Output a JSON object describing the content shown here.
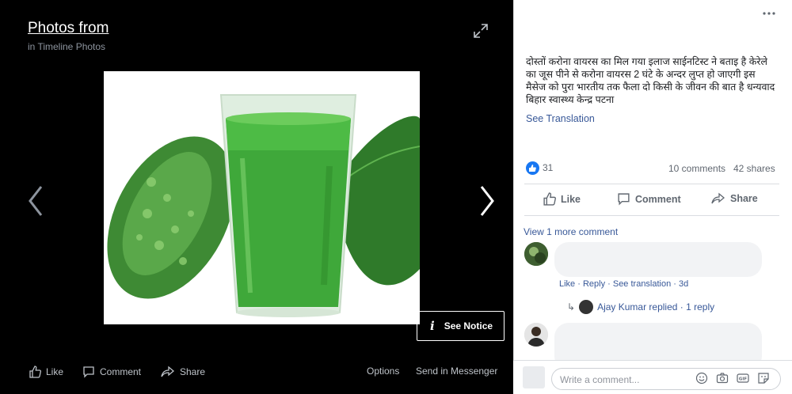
{
  "viewer": {
    "album_title": "Photos from",
    "album_subtitle": "in Timeline Photos",
    "see_notice": "See Notice",
    "bottom": {
      "like": "Like",
      "comment": "Comment",
      "share": "Share",
      "options": "Options",
      "send": "Send in Messenger"
    }
  },
  "post": {
    "caption": "दोस्तों करोना वायरस का मिल गया इलाज साईनटिस्ट ने बताइ है केरेले का जूस पीने से करोना वायरस 2 घंटे के अन्दर लुप्त हो जाएगी इस मैसेज को पुरा भारतीय तक फैला दो किसी के जीवन की बात है धन्यवाद बिहार स्वास्थ्य केन्द्र पटना",
    "see_translation": "See Translation",
    "reactions": "31",
    "comments": "10 comments",
    "shares": "42 shares",
    "actions": {
      "like": "Like",
      "comment": "Comment",
      "share": "Share"
    }
  },
  "comments": {
    "view_more": "View 1 more comment",
    "meta": "Like · Reply · See translation · 3d",
    "replied": "Ajay Kumar replied · 1 reply"
  },
  "composer": {
    "placeholder": "Write a comment..."
  },
  "colors": {
    "accent": "#1877f2",
    "link": "#385898",
    "juice": "#3fa83a"
  }
}
